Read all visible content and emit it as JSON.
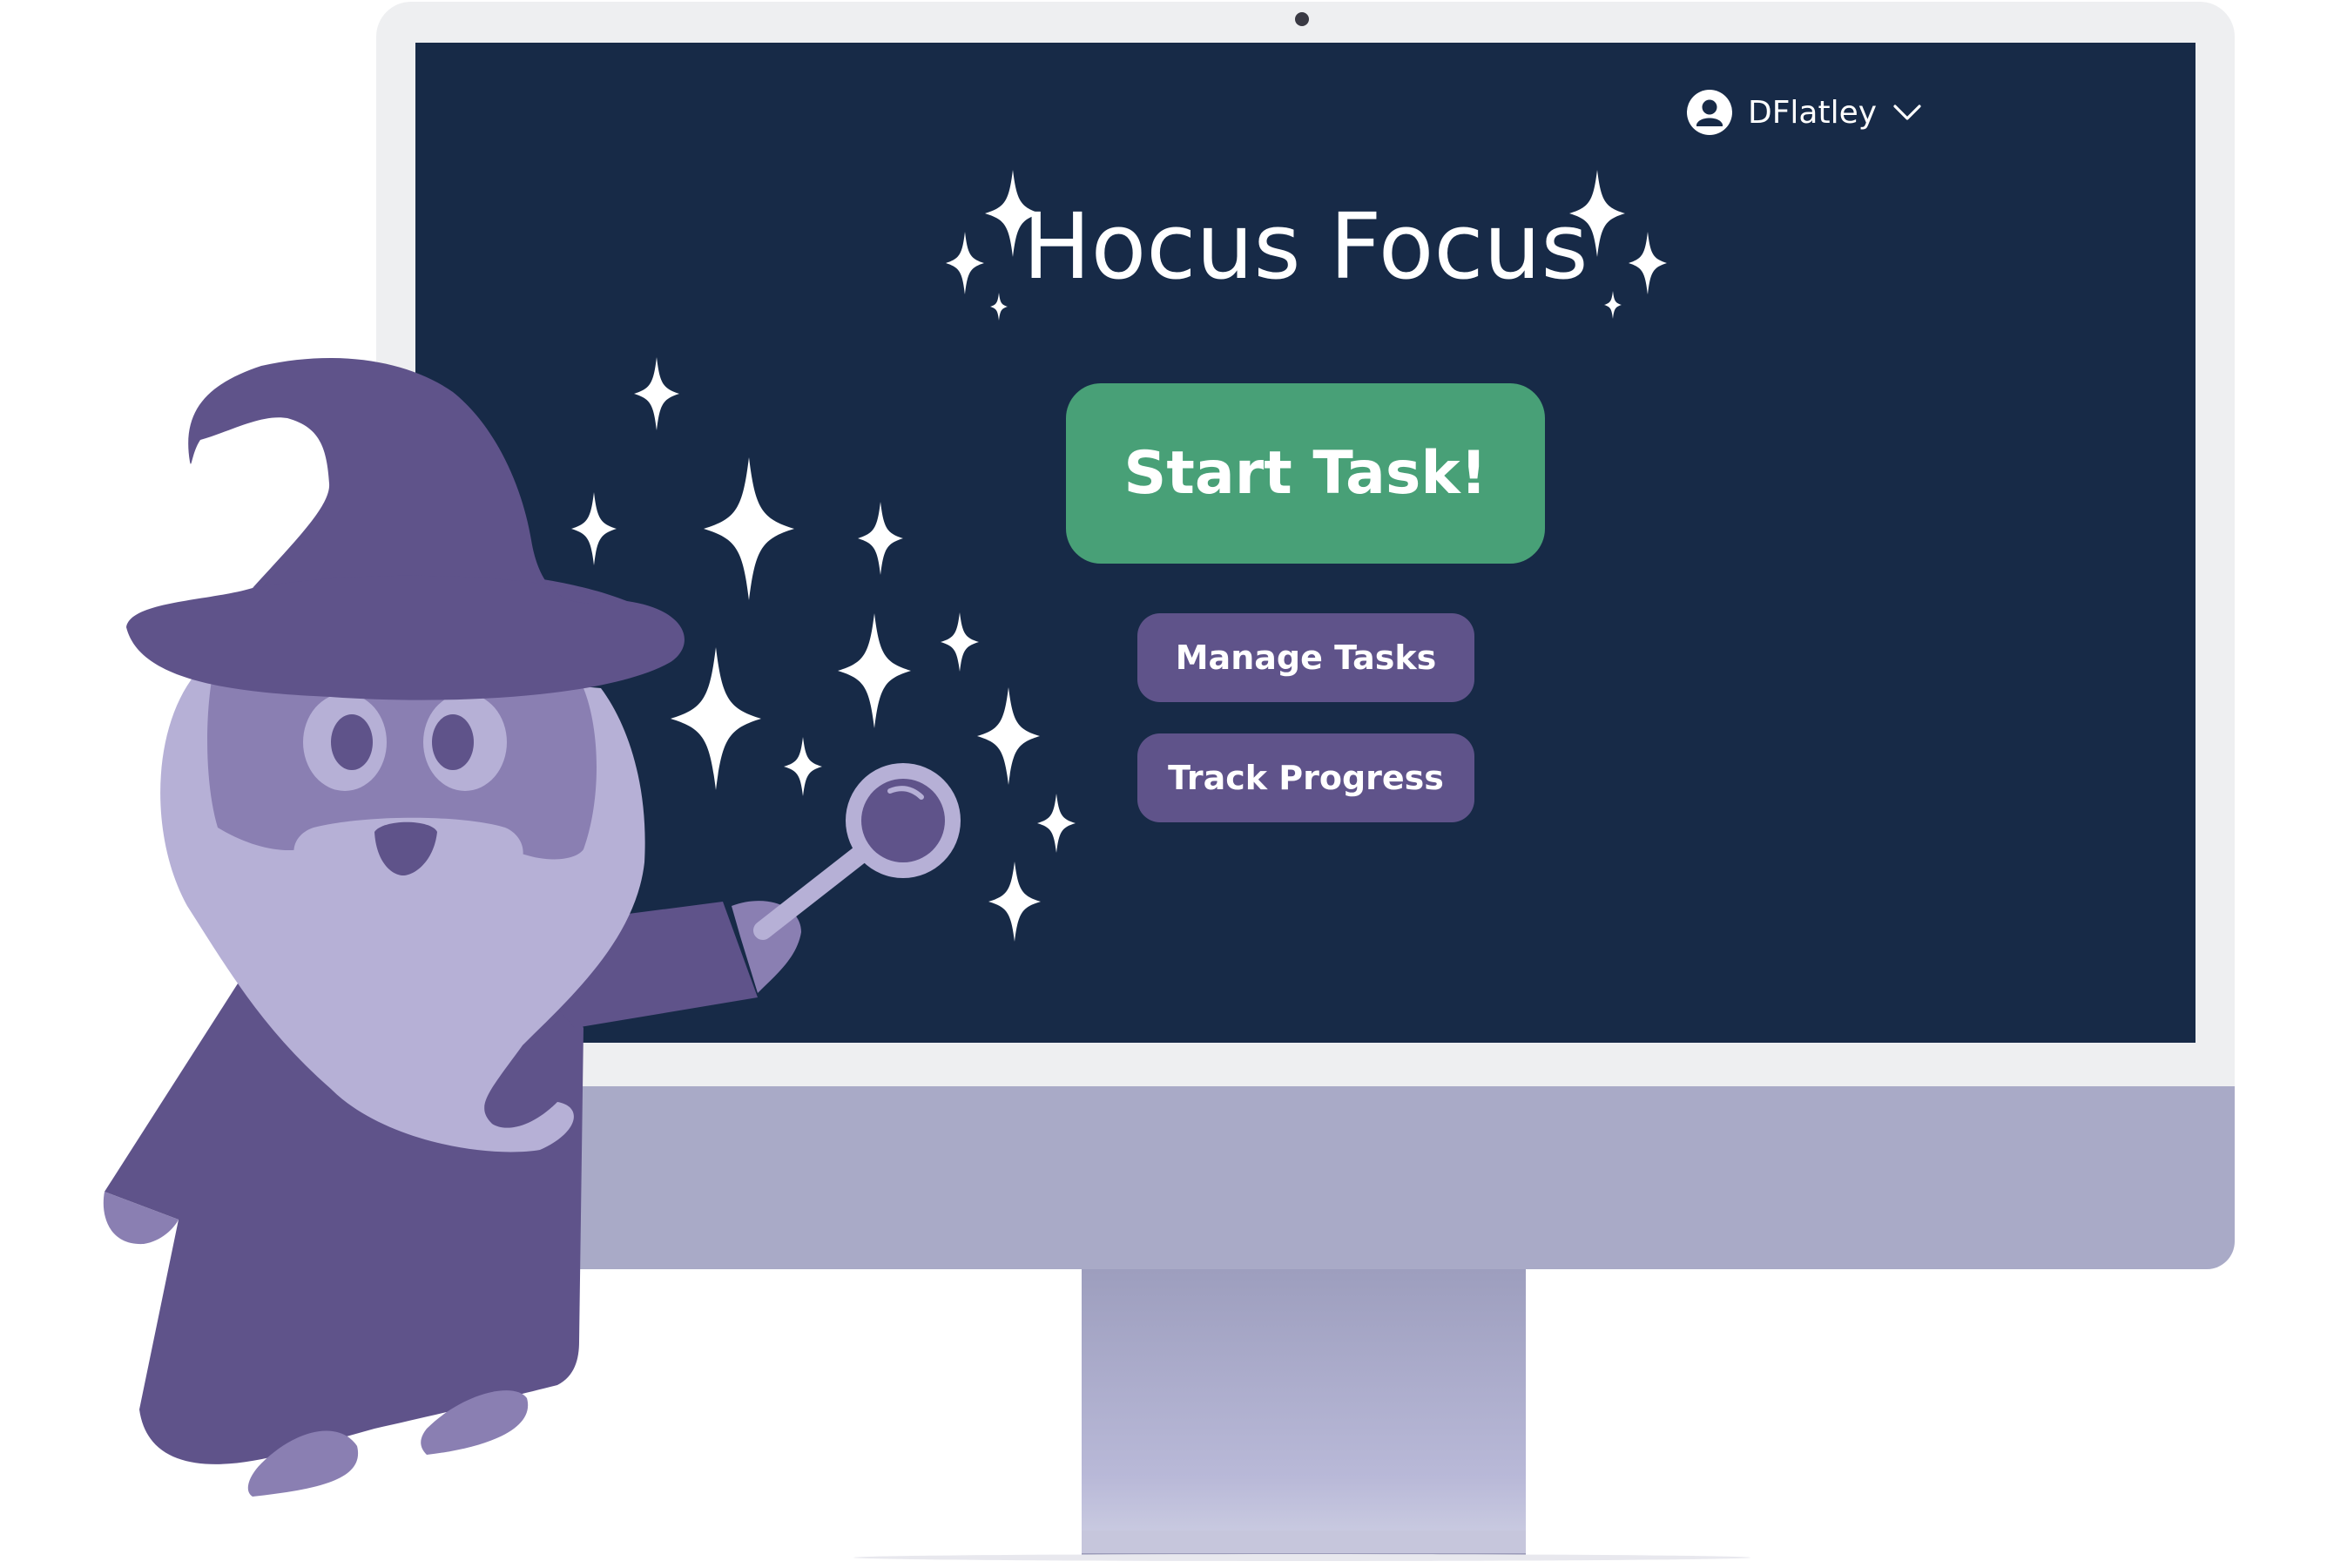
{
  "app": {
    "title": "Hocus Focus"
  },
  "user_menu": {
    "username": "DFlatley",
    "avatar_icon": "user-circle-icon",
    "dropdown_icon": "chevron-down-icon"
  },
  "main_actions": {
    "start_task_label": "Start Task!",
    "manage_tasks_label": "Manage Tasks",
    "track_progress_label": "Track Progress"
  },
  "colors": {
    "screen_background": "#172a47",
    "start_button": "#48a077",
    "secondary_buttons": "#5f538a",
    "wizard_robe": "#5f538a",
    "wizard_beard": "#b6b0d6",
    "text": "#ffffff"
  }
}
